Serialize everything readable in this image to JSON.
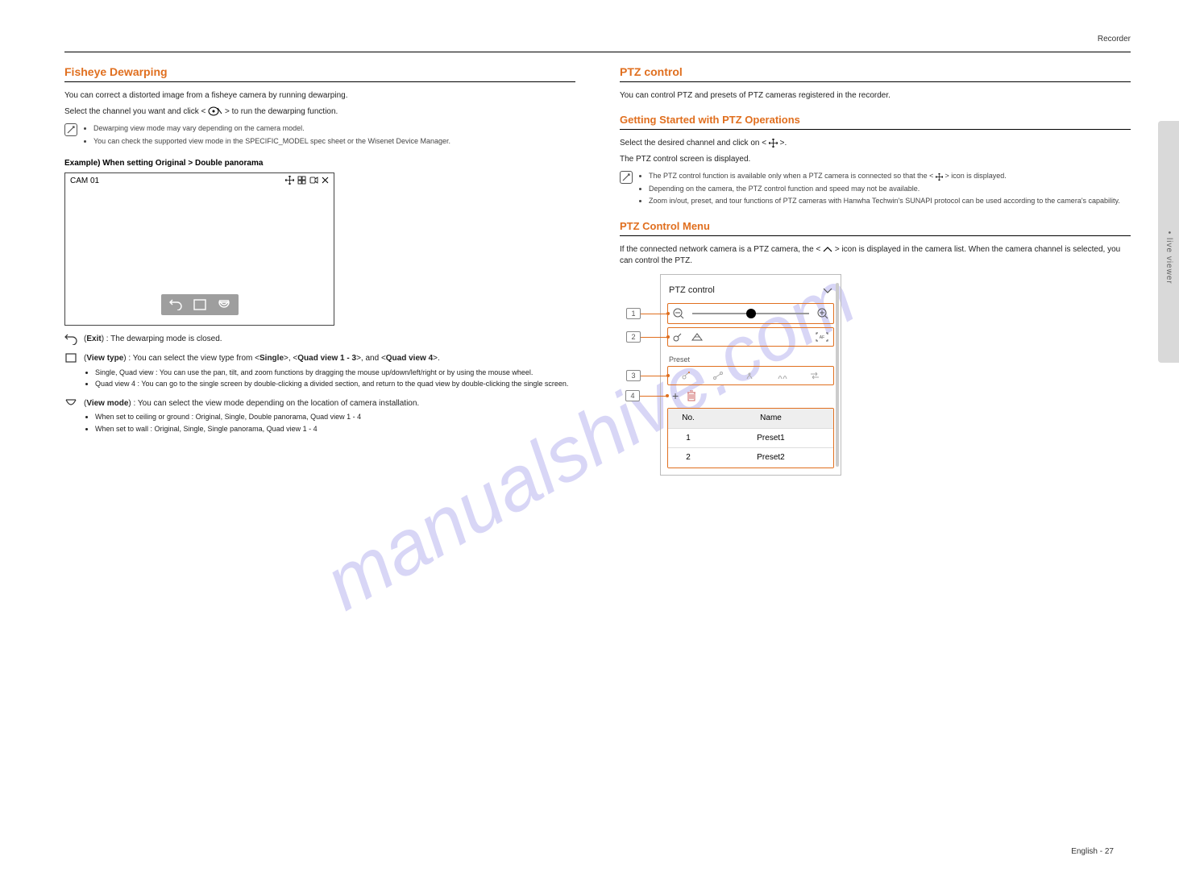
{
  "header": {
    "breadcrumb": "Recorder"
  },
  "watermark": "manualshive.com",
  "sidetab": {
    "label": "• live viewer"
  },
  "left": {
    "title": "Fisheye Dewarping",
    "intro1_pre": "You can correct a distorted image from a fisheye camera by running dewarping.",
    "intro1_post": "Select the channel you want and click < ",
    "intro2": " > to run the dewarping function.",
    "note_items": [
      "Dewarping view mode may vary depending on the camera model.",
      "You can check the supported view mode in the SPECIFIC_MODEL spec sheet or the Wisenet Device Manager."
    ],
    "example_label": "Example) When setting Original > Double panorama",
    "cam_label": "CAM 01",
    "icons": {
      "undo_name": "undo-icon",
      "undo_text_pre": " (",
      "undo_text_mid_label": "Exit",
      "undo_text_end": ") : The dewarping mode is closed.",
      "square_text_pre": " (",
      "square_label": "View type",
      "square_text_mid": ") : You can select the view type from <",
      "square_single": "Single",
      "square_q1": ">, <",
      "square_q1_label": "Quad view 1 - 3",
      "square_q2": ">, and <",
      "square_q2_label": "Quad view 4",
      "square_text_end": ">.",
      "square_sub": [
        "Single, Quad view : You can use the pan, tilt, and zoom functions by dragging the mouse up/down/left/right or by using the mouse wheel.",
        "Quad view 4 : You can go to the single screen by double-clicking a divided section, and return to the quad view by double-clicking the single screen."
      ],
      "dome_text_pre": " (",
      "dome_label": "View mode",
      "dome_text_mid": ") : You can select the view mode depending on the location of camera installation.",
      "dome_sub": [
        "When set to ceiling or ground : Original, Single, Double panorama, Quad view 1 - 4",
        "When set to wall : Original, Single, Single panorama, Quad view 1 - 4"
      ]
    }
  },
  "right": {
    "title": "PTZ control",
    "intro": "You can control PTZ and presets of PTZ cameras registered in the recorder.",
    "sub1_title": "Getting Started with PTZ Operations",
    "sub1_body_pre": "Select the desired channel and click on < ",
    "sub1_body_post": " >.",
    "sub1_body2": "The PTZ control screen is displayed.",
    "sub1_note_pre": "The PTZ control function is available only when a PTZ camera is connected so that the < ",
    "sub1_note_post": " > icon is displayed.",
    "sub1_note2": "Depending on the camera, the PTZ control function and speed may not be available.",
    "sub1_note3": "Zoom in/out, preset, and tour functions of PTZ cameras with Hanwha Techwin's SUNAPI protocol can be used according to the camera's capability.",
    "sub2_title": "PTZ Control Menu",
    "sub2_body_pre": "If the connected network camera is a PTZ camera, the < ",
    "sub2_body_post": " > icon is displayed in the camera list. When the camera channel is selected, you can control the PTZ.",
    "ptz_panel": {
      "header": "PTZ control",
      "preset_section_label": "Preset",
      "add_icon_label": "+",
      "table": {
        "headers": {
          "no": "No.",
          "name": "Name"
        },
        "rows": [
          {
            "no": "1",
            "name": "Preset1"
          },
          {
            "no": "2",
            "name": "Preset2"
          }
        ]
      }
    }
  },
  "footer": {
    "section": "live viewer",
    "page": "27"
  }
}
